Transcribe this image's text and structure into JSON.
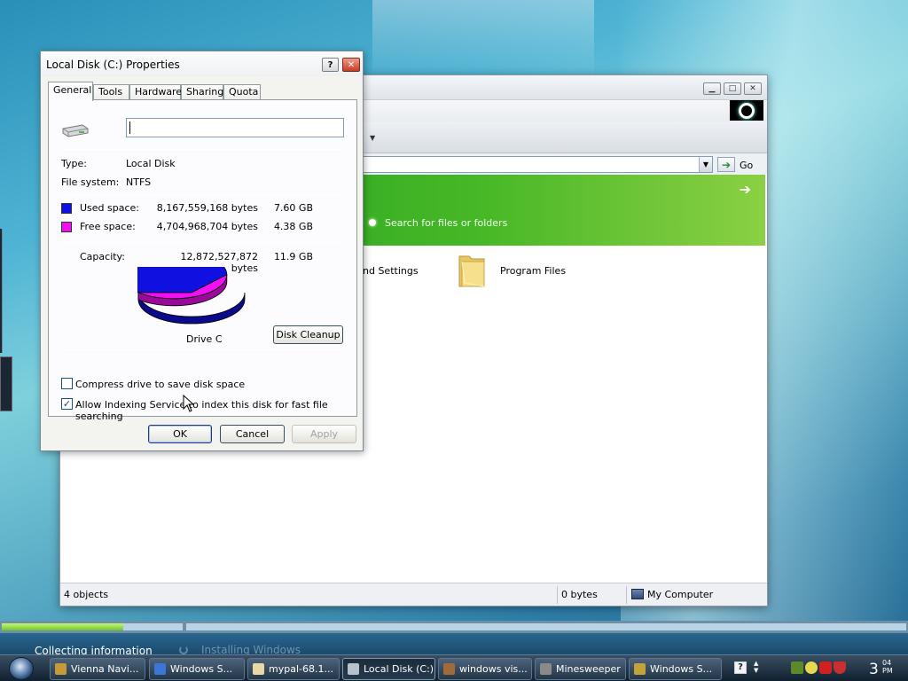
{
  "dialog": {
    "title": "Local Disk (C:) Properties",
    "help_label": "?",
    "close_label": "✕",
    "tabs": [
      "General",
      "Tools",
      "Hardware",
      "Sharing",
      "Quota"
    ],
    "active_tab": "General",
    "name_value": "",
    "type_label": "Type:",
    "type_value": "Local Disk",
    "fs_label": "File system:",
    "fs_value": "NTFS",
    "used_label": "Used space:",
    "used_bytes": "8,167,559,168 bytes",
    "used_gb": "7.60 GB",
    "free_label": "Free space:",
    "free_bytes": "4,704,968,704 bytes",
    "free_gb": "4.38 GB",
    "capacity_label": "Capacity:",
    "capacity_bytes": "12,872,527,872 bytes",
    "capacity_gb": "11.9 GB",
    "used_fraction": 0.6345,
    "drive_label": "Drive C",
    "cleanup_button": "Disk Cleanup",
    "compress_label": "Compress drive to save disk space",
    "compress_checked": false,
    "indexing_label": "Allow Indexing Service to index this disk for fast file searching",
    "indexing_checked": true,
    "ok_button": "OK",
    "cancel_button": "Cancel",
    "apply_button": "Apply",
    "colors": {
      "used": "#1010e0",
      "free": "#f010f0"
    }
  },
  "explorer": {
    "address_go": "Go",
    "search_link": "Search for files or folders",
    "items": [
      {
        "label": "nd Settings"
      },
      {
        "label": "Program Files"
      }
    ],
    "status": {
      "objects": "4 objects",
      "size": "0 bytes",
      "location": "My Computer"
    },
    "minimize": "▁",
    "maximize": "□",
    "close": "✕"
  },
  "setup": {
    "status_left": "Collecting information",
    "status_right": "Installing Windows",
    "progress_fraction": 0.67
  },
  "taskbar": {
    "buttons": [
      {
        "label": "Vienna Navi...",
        "color": "#c49a3a"
      },
      {
        "label": "Windows S...",
        "color": "#3b78d6"
      },
      {
        "label": "mypal-68.1...",
        "color": "#e8d8a8"
      },
      {
        "label": "Local Disk (C:)",
        "color": "#b8c2cc"
      },
      {
        "label": "windows vis...",
        "color": "#a06a3a"
      },
      {
        "label": "Minesweeper",
        "color": "#8a8a8a"
      },
      {
        "label": "Windows S...",
        "color": "#c4a23a"
      }
    ],
    "active_button": "Local Disk (C:)",
    "tray_help": "?",
    "clock_hour": "3",
    "clock_minutes": "04",
    "clock_ampm": "PM"
  }
}
